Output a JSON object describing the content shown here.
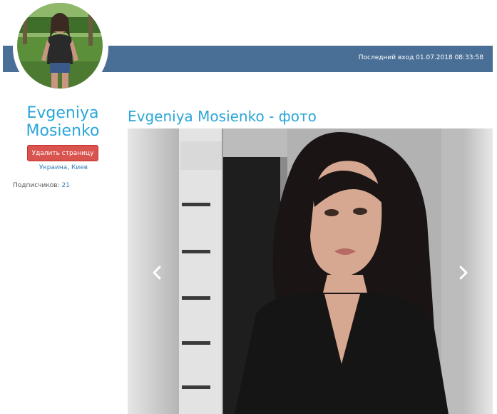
{
  "header": {
    "last_login": "Последний вход 01.07.2018 08:33:58",
    "bar_color": "#4a6f96"
  },
  "profile": {
    "name": "Evgeniya Mosienko",
    "delete_button": "Удалить страницу",
    "location": "Украина, Киев",
    "subscribers_label": "Подписчиков:",
    "subscribers_count": "21",
    "name_color": "#2aa6d9",
    "delete_color": "#d9534f"
  },
  "gallery": {
    "title": "Evgeniya Mosienko - фото",
    "prev_icon": "chevron-left-icon",
    "next_icon": "chevron-right-icon"
  }
}
